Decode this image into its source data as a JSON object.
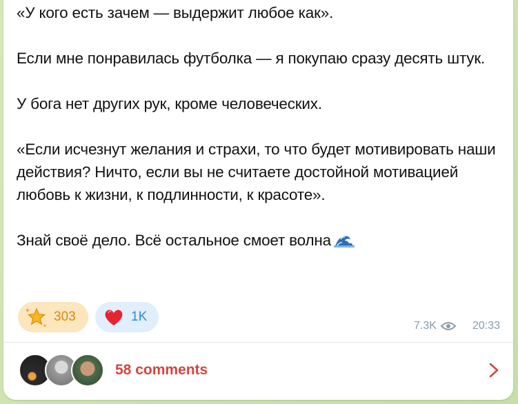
{
  "message": {
    "paragraphs": [
      "«У кого есть зачем — выдержит любое как».",
      "Если мне понравилась футболка — я покупаю сразу десять штук.",
      "У бога нет других рук, кроме человеческих.",
      "«Если исчезнут желания и страхи, то что будет мотивировать наши действия? Ничто, если вы не считаете достойной мотивацией любовь к жизни, к подлинности, к красоте».",
      "Знай своё дело. Всё остальное смоет волна"
    ],
    "trailing_emoji": "wave-emoji"
  },
  "reactions": [
    {
      "icon": "star-icon",
      "count": "303",
      "color": "#e0860a",
      "bg": "#fbe6bd"
    },
    {
      "icon": "heart-icon",
      "count": "1K",
      "color": "#2f8bdc",
      "bg": "#e1eefb"
    }
  ],
  "meta": {
    "views": "7.3K",
    "time": "20:33"
  },
  "comments": {
    "label": "58 comments",
    "accent": "#d2453f"
  }
}
